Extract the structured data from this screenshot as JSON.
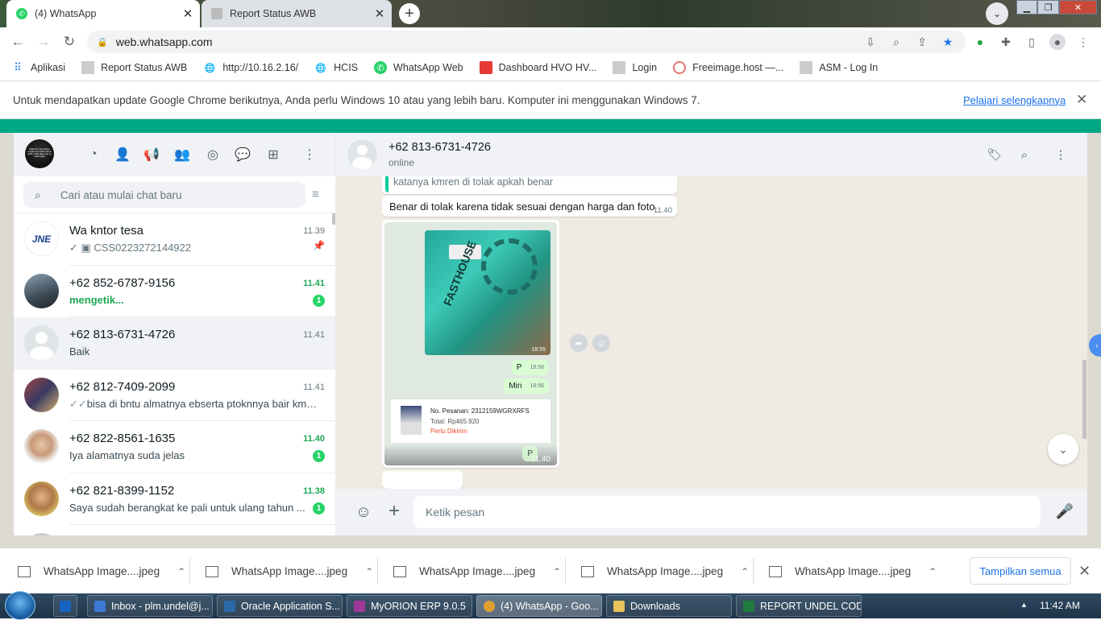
{
  "browser": {
    "tabs": [
      {
        "title": "(4) WhatsApp",
        "active": true
      },
      {
        "title": "Report Status AWB",
        "active": false
      }
    ],
    "url": "web.whatsapp.com",
    "bookmarks": [
      {
        "label": "Aplikasi",
        "icon": "apps-grid-icon"
      },
      {
        "label": "Report Status AWB",
        "icon": "page-icon"
      },
      {
        "label": "http://10.16.2.16/",
        "icon": "globe-icon"
      },
      {
        "label": "HCIS",
        "icon": "globe-icon"
      },
      {
        "label": "WhatsApp Web",
        "icon": "whatsapp-icon"
      },
      {
        "label": "Dashboard HVO HV...",
        "icon": "dashboard-icon"
      },
      {
        "label": "Login",
        "icon": "page-icon"
      },
      {
        "label": "Freeimage.host —...",
        "icon": "freeimage-icon"
      },
      {
        "label": "ASM - Log In",
        "icon": "page-icon"
      }
    ],
    "infobar": {
      "message": "Untuk mendapatkan update Google Chrome berikutnya, Anda perlu Windows 10 atau yang lebih baru. Komputer ini menggunakan Windows 7.",
      "link": "Pelajari selengkapnya"
    }
  },
  "whatsapp": {
    "accent": "#00a884",
    "search_placeholder": "Cari atau mulai chat baru",
    "my_avatar_text": "Walmon must aktie rmgaan no sukl wanta false what aap clue tp vuelo jatta",
    "chats": [
      {
        "name": "Wa kntor tesa",
        "time": "11.39",
        "message": "CSS0223272144922",
        "time_green": false,
        "unread": "",
        "pinned": true,
        "msg_green": false,
        "prefix": "✓ ▣ "
      },
      {
        "name": "+62 852-6787-9156",
        "time": "11.41",
        "message": "mengetik...",
        "time_green": true,
        "unread": "1",
        "pinned": false,
        "msg_green": true,
        "prefix": ""
      },
      {
        "name": "+62 813-6731-4726",
        "time": "11.41",
        "message": "Baik",
        "time_green": false,
        "unread": "",
        "pinned": false,
        "msg_green": false,
        "prefix": "",
        "active": true
      },
      {
        "name": "+62 812-7409-2099",
        "time": "11.41",
        "message": "bisa di bntu almatnya ebserta ptoknnya bair kmi p...",
        "time_green": false,
        "unread": "",
        "pinned": false,
        "msg_green": false,
        "prefix": "✓✓"
      },
      {
        "name": "+62 822-8561-1635",
        "time": "11.40",
        "message": "Iya alamatnya suda jelas",
        "time_green": true,
        "unread": "1",
        "pinned": false,
        "msg_green": false,
        "prefix": ""
      },
      {
        "name": "+62 821-8399-1152",
        "time": "11.38",
        "message": "Saya sudah berangkat ke pali untuk ulang tahun ...",
        "time_green": true,
        "unread": "1",
        "pinned": false,
        "msg_green": false,
        "prefix": ""
      }
    ],
    "conversation": {
      "contact": "+62 813-6731-4726",
      "status": "online",
      "quoted_text": "katanya kmren di tolak apkah benar",
      "message1": "Benar di tolak karena tidak sesuai dengan harga dan foto",
      "message1_time": "11.40",
      "image_time": "11.40",
      "photo_time": "18:55",
      "image_inner_bubbles": [
        {
          "text": "P",
          "time": "18:56"
        },
        {
          "text": "Min",
          "time": "18:56"
        }
      ],
      "inner_bottom_bubble": "P",
      "order_card": {
        "order_no": "No. Pesanan: 2312159WGRXRFS",
        "total": "Total: Rp465.920",
        "status": "Perlu Dikirim"
      },
      "photo_brand_text": "FASTHOUSE",
      "input_placeholder": "Ketik pesan"
    }
  },
  "downloads": {
    "items": [
      "WhatsApp Image....jpeg",
      "WhatsApp Image....jpeg",
      "WhatsApp Image....jpeg",
      "WhatsApp Image....jpeg",
      "WhatsApp Image....jpeg"
    ],
    "show_all": "Tampilkan semua"
  },
  "taskbar": {
    "items": [
      {
        "label": "Inbox - plm.undel@j...",
        "color": "#3d7ad6"
      },
      {
        "label": "Oracle Application S...",
        "color": "#2a6aa8"
      },
      {
        "label": "MyORION ERP 9.0.5",
        "color": "#a0389c"
      },
      {
        "label": "(4) WhatsApp - Goo...",
        "color": "#e0a030",
        "active": true
      },
      {
        "label": "Downloads",
        "color": "#e8c25a"
      },
      {
        "label": "REPORT UNDEL COD...",
        "color": "#1f7a3e"
      }
    ],
    "clock": "11:42 AM"
  }
}
